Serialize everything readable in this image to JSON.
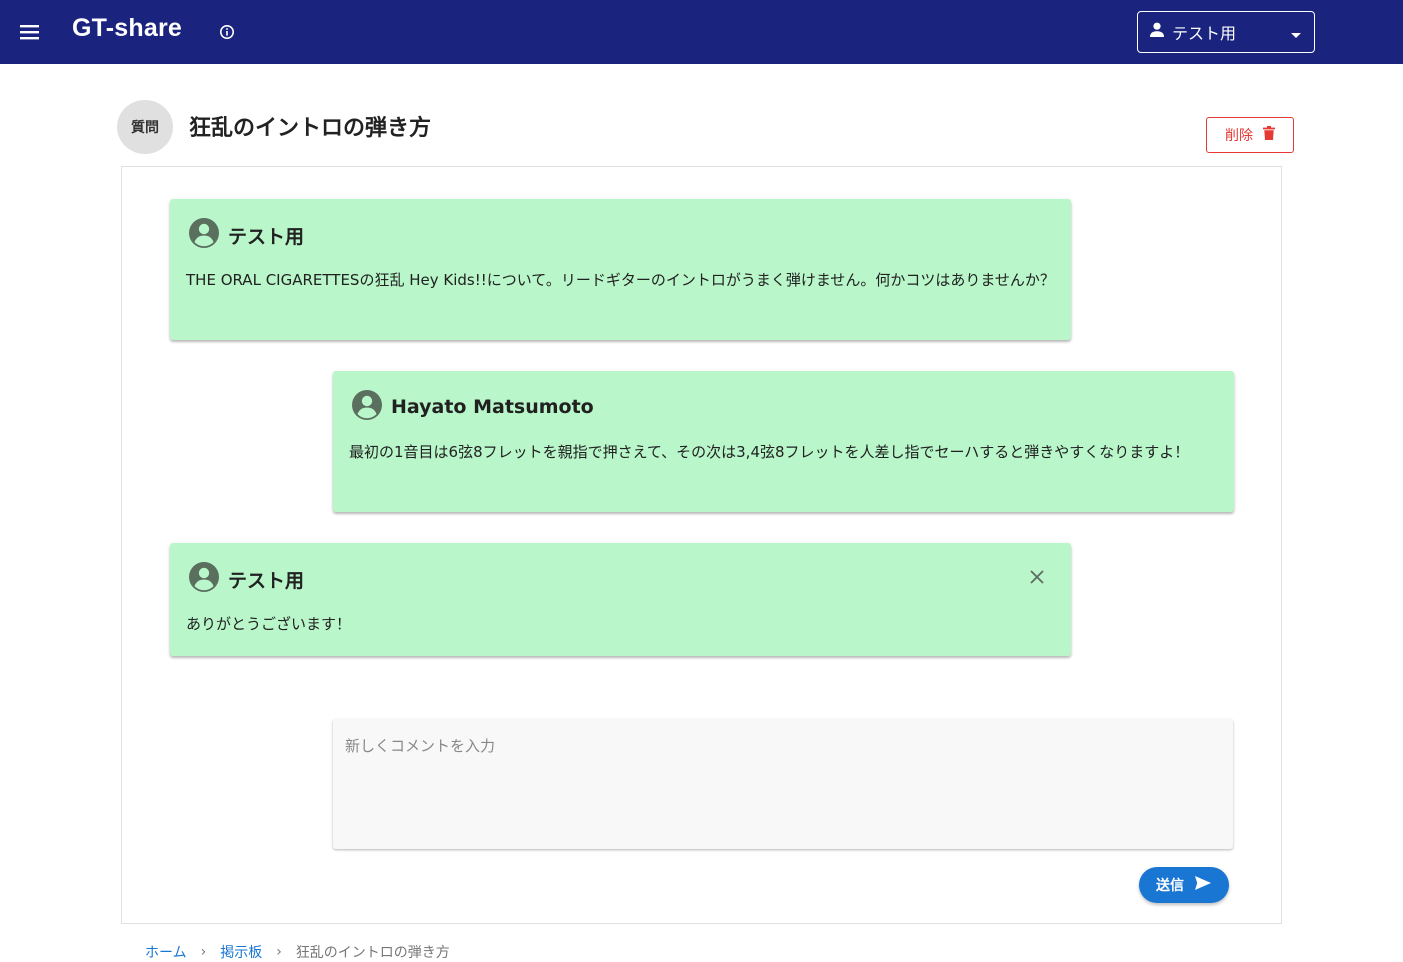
{
  "appbar": {
    "title": "GT-share",
    "user_select": {
      "selected": "テスト用"
    }
  },
  "header": {
    "category_badge": "質問",
    "title": "狂乱のイントロの弾き方",
    "delete_label": "削除"
  },
  "messages": [
    {
      "author": "テスト用",
      "body": "THE ORAL CIGARETTESの狂乱 Hey Kids!!について。リードギターのイントロがうまく弾けません。何かコツはありませんか？"
    },
    {
      "author": "Hayato Matsumoto",
      "body": "最初の1音目は6弦8フレットを親指で押さえて、その次は3,4弦8フレットを人差し指でセーハすると弾きやすくなりますよ！"
    },
    {
      "author": "テスト用",
      "body": "ありがとうございます！"
    }
  ],
  "comment": {
    "placeholder": "新しくコメントを入力",
    "value": "",
    "send_label": "送信"
  },
  "breadcrumb": {
    "items": [
      "ホーム",
      "掲示板",
      "狂乱のイントロの弾き方"
    ]
  },
  "colors": {
    "appbar": "#1a237e",
    "message_bg": "#b9f6ca",
    "accent": "#1976d2",
    "danger": "#e53935"
  }
}
